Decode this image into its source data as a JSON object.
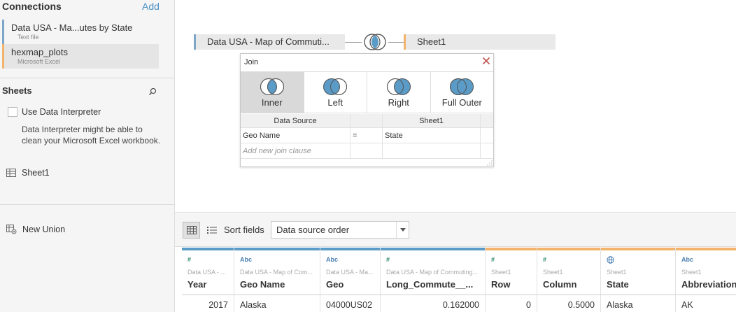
{
  "connections": {
    "title": "Connections",
    "add_label": "Add",
    "items": [
      {
        "name": "Data USA - Ma...utes by State",
        "type": "Text file"
      },
      {
        "name": "hexmap_plots",
        "type": "Microsoft Excel"
      }
    ]
  },
  "sheets": {
    "title": "Sheets",
    "interpreter_label": "Use Data Interpreter",
    "interpreter_desc": "Data Interpreter might be able to clean your Microsoft Excel workbook.",
    "items": [
      {
        "name": "Sheet1"
      }
    ],
    "new_union": "New Union"
  },
  "canvas": {
    "left_table": "Data USA - Map of Commuti...",
    "right_table": "Sheet1"
  },
  "join": {
    "title": "Join",
    "types": [
      {
        "label": "Inner",
        "active": true
      },
      {
        "label": "Left",
        "active": false
      },
      {
        "label": "Right",
        "active": false
      },
      {
        "label": "Full Outer",
        "active": false
      }
    ],
    "headers": {
      "left": "Data Source",
      "right": "Sheet1"
    },
    "clause": {
      "left": "Geo Name",
      "op": "=",
      "right": "State"
    },
    "add_clause": "Add new join clause"
  },
  "toolbar": {
    "sort_label": "Sort fields",
    "sort_value": "Data source order"
  },
  "grid": {
    "columns": [
      {
        "type": "#",
        "source": "Data USA - ...",
        "name": "Year",
        "value": "2017"
      },
      {
        "type": "Abc",
        "source": "Data USA - Map of Com...",
        "name": "Geo Name",
        "value": "Alaska"
      },
      {
        "type": "Abc",
        "source": "Data USA - Ma...",
        "name": "Geo",
        "value": "04000US02"
      },
      {
        "type": "#",
        "source": "Data USA - Map of Commuting...",
        "name": "Long_Commute__...",
        "value": "0.162000"
      },
      {
        "type": "#",
        "source": "Sheet1",
        "name": "Row",
        "value": "0"
      },
      {
        "type": "#",
        "source": "Sheet1",
        "name": "Column",
        "value": "0.5000"
      },
      {
        "type": "globe",
        "source": "Sheet1",
        "name": "State",
        "value": "Alaska"
      },
      {
        "type": "Abc",
        "source": "Sheet1",
        "name": "Abbreviation",
        "value": "AK"
      }
    ]
  }
}
